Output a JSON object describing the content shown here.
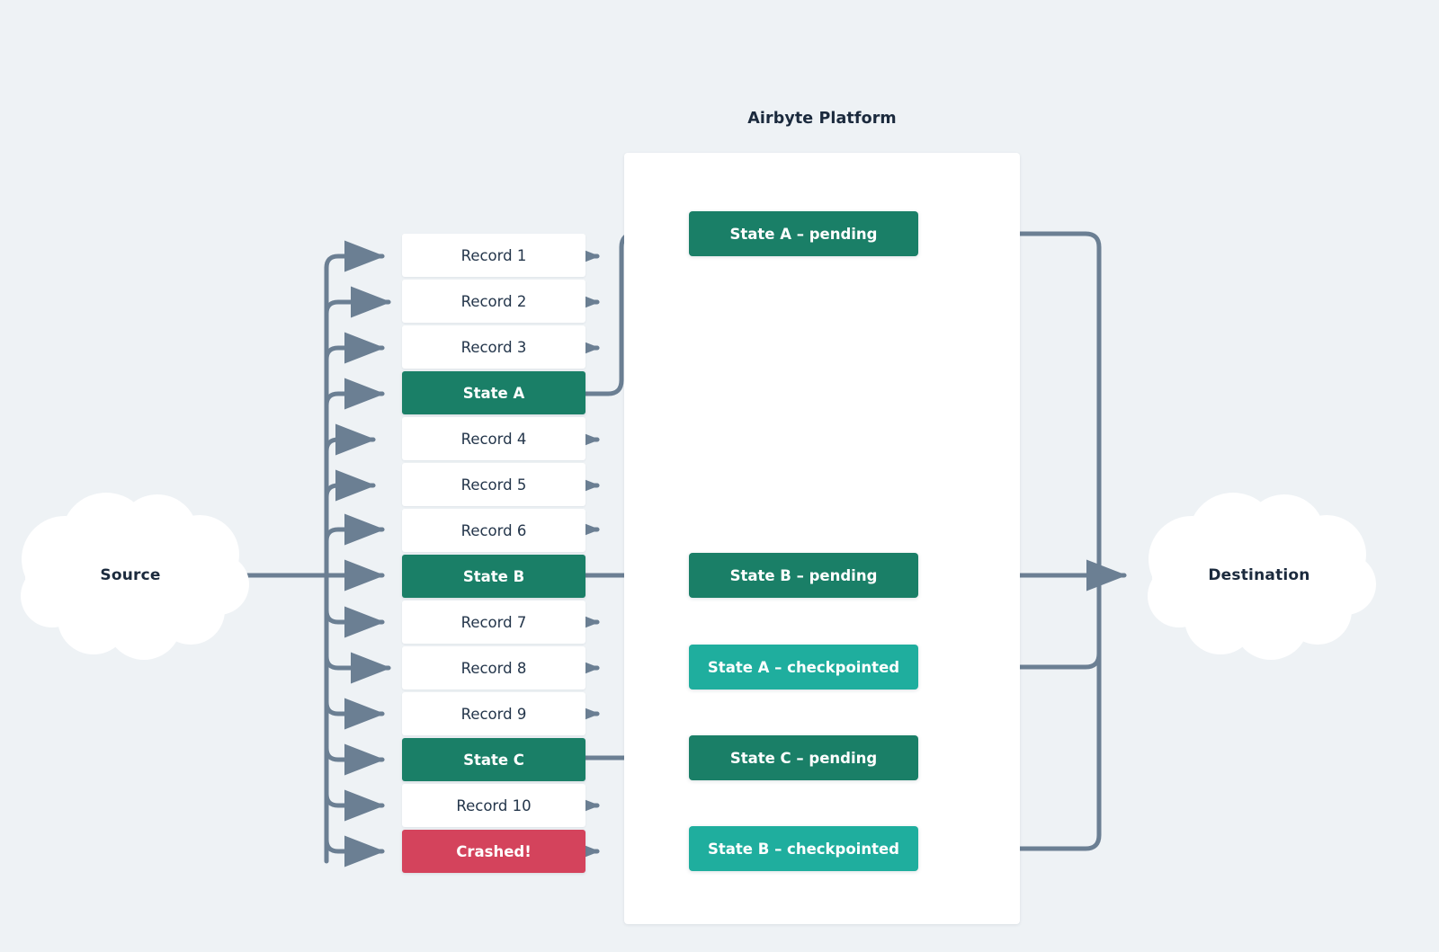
{
  "diagram": {
    "title": "Airbyte Platform",
    "background_color": "#eef2f5",
    "line_color": "#6b7f93"
  },
  "source": {
    "label": "Source"
  },
  "destination": {
    "label": "Destination"
  },
  "stack": {
    "rows": [
      {
        "label": "Record 1",
        "kind": "record"
      },
      {
        "label": "Record 2",
        "kind": "record"
      },
      {
        "label": "Record 3",
        "kind": "record"
      },
      {
        "label": "State A",
        "kind": "state"
      },
      {
        "label": "Record 4",
        "kind": "record"
      },
      {
        "label": "Record 5",
        "kind": "record"
      },
      {
        "label": "Record 6",
        "kind": "record"
      },
      {
        "label": "State B",
        "kind": "state"
      },
      {
        "label": "Record 7",
        "kind": "record"
      },
      {
        "label": "Record 8",
        "kind": "record"
      },
      {
        "label": "Record 9",
        "kind": "record"
      },
      {
        "label": "State C",
        "kind": "state"
      },
      {
        "label": "Record 10",
        "kind": "record"
      },
      {
        "label": "Crashed!",
        "kind": "crashed"
      }
    ]
  },
  "platform": {
    "boxes": [
      {
        "label": "State A – pending",
        "kind": "pending",
        "color": "#1a7f67"
      },
      {
        "label": "State B – pending",
        "kind": "pending",
        "color": "#1a7f67"
      },
      {
        "label": "State A – checkpointed",
        "kind": "checkpointed",
        "color": "#1fae9e"
      },
      {
        "label": "State C – pending",
        "kind": "pending",
        "color": "#1a7f67"
      },
      {
        "label": "State B – checkpointed",
        "kind": "checkpointed",
        "color": "#1fae9e"
      }
    ]
  }
}
